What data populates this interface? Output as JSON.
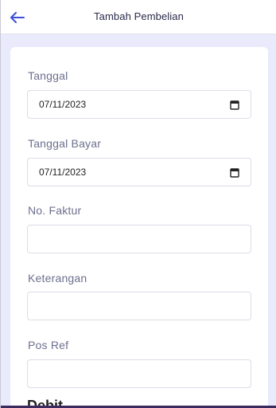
{
  "header": {
    "back_icon": "arrow-left-icon",
    "title": "Tambah Pembelian",
    "accent": "#3d4fd8"
  },
  "form": {
    "tanggal_label": "Tanggal",
    "tanggal_value": "07/11/2023",
    "tanggal_bayar_label": "Tanggal Bayar",
    "tanggal_bayar_value": "07/11/2023",
    "no_faktur_label": "No. Faktur",
    "no_faktur_value": "",
    "keterangan_label": "Keterangan",
    "keterangan_value": "",
    "pos_ref_label": "Pos Ref",
    "pos_ref_value": "",
    "debit_section_title": "Debit"
  }
}
